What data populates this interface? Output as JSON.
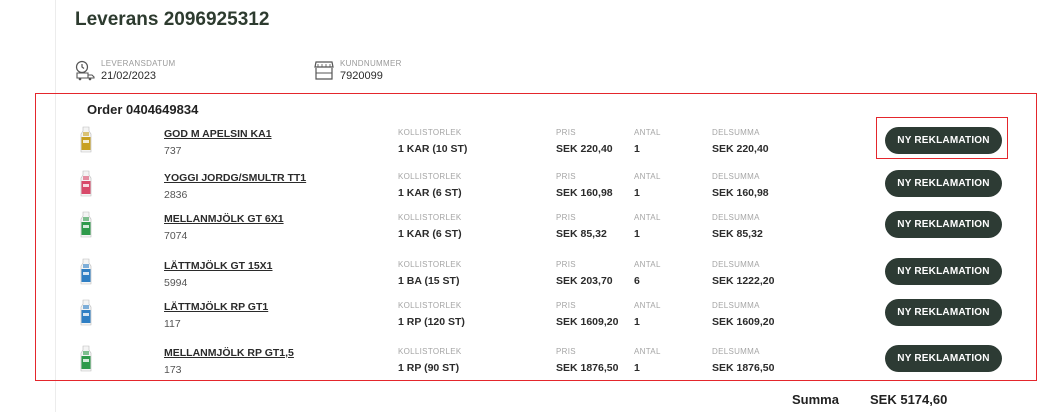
{
  "delivery": {
    "title": "Leverans 2096925312",
    "date_label": "LEVERANSDATUM",
    "date_value": "21/02/2023",
    "customer_label": "KUNDNUMMER",
    "customer_value": "7920099"
  },
  "order": {
    "title": "Order 0404649834",
    "column_labels": {
      "package": "KOLLISTORLEK",
      "price": "PRIS",
      "quantity": "ANTAL",
      "subtotal": "DELSUMMA"
    },
    "button_label": "NY REKLAMATION",
    "items": [
      {
        "name": "GOD M APELSIN KA1",
        "number": "737",
        "package": "1 KAR (10 ST)",
        "price": "SEK 220,40",
        "quantity": "1",
        "subtotal": "SEK 220,40",
        "icon": "juice-bottle-icon",
        "color": "#c8a020"
      },
      {
        "name": "YOGGI JORDG/SMULTR TT1",
        "number": "2836",
        "package": "1 KAR (6 ST)",
        "price": "SEK 160,98",
        "quantity": "1",
        "subtotal": "SEK 160,98",
        "icon": "yoghurt-carton-icon",
        "color": "#d84a6a"
      },
      {
        "name": "MELLANMJÖLK GT 6X1",
        "number": "7074",
        "package": "1 KAR (6 ST)",
        "price": "SEK 85,32",
        "quantity": "1",
        "subtotal": "SEK 85,32",
        "icon": "milk-carton-icon",
        "color": "#2e9a4a"
      },
      {
        "name": "LÄTTMJÖLK GT 15X1",
        "number": "5994",
        "package": "1 BA (15 ST)",
        "price": "SEK 203,70",
        "quantity": "6",
        "subtotal": "SEK 1222,20",
        "icon": "milk-carton-icon",
        "color": "#2f7fc4"
      },
      {
        "name": "LÄTTMJÖLK RP GT1",
        "number": "117",
        "package": "1 RP (120 ST)",
        "price": "SEK 1609,20",
        "quantity": "1",
        "subtotal": "SEK 1609,20",
        "icon": "milk-carton-icon",
        "color": "#2f7fc4"
      },
      {
        "name": "MELLANMJÖLK RP GT1,5",
        "number": "173",
        "package": "1 RP (90 ST)",
        "price": "SEK 1876,50",
        "quantity": "1",
        "subtotal": "SEK 1876,50",
        "icon": "milk-carton-icon",
        "color": "#2e9a4a"
      }
    ]
  },
  "total": {
    "label": "Summa",
    "value": "SEK 5174,60"
  }
}
